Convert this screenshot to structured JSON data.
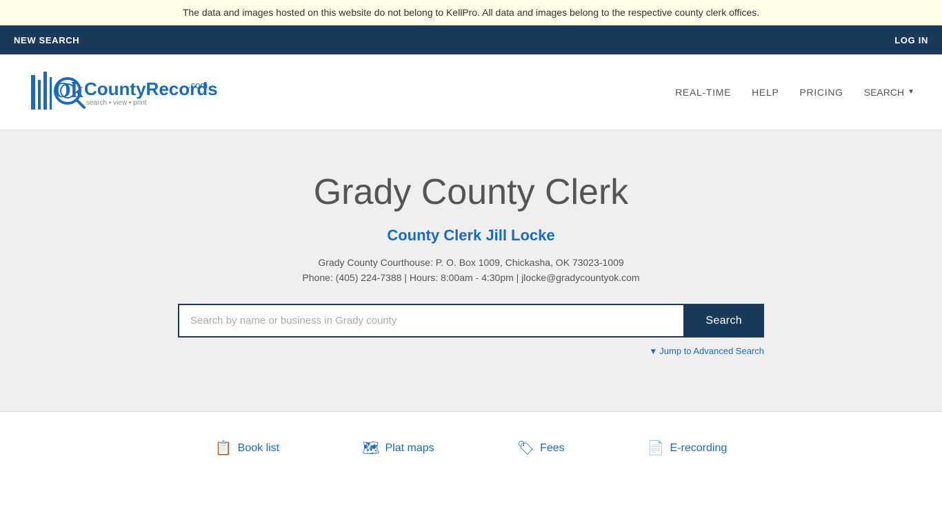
{
  "notice": {
    "text": "The data and images hosted on this website do not belong to KellPro. All data and images belong to the respective county clerk offices."
  },
  "topnav": {
    "new_search": "NEW SEARCH",
    "log_in": "LOG IN"
  },
  "header": {
    "logo_ok": "Ok",
    "logo_county": "County",
    "logo_records": "Records",
    "logo_com": ".com",
    "logo_tagline": "search • view • print",
    "nav_realtime": "REAL-TIME",
    "nav_help": "HELP",
    "nav_pricing": "PRICING",
    "nav_search": "SEARCH"
  },
  "hero": {
    "title": "Grady County Clerk",
    "clerk_name": "County Clerk Jill Locke",
    "address": "Grady County Courthouse: P. O. Box 1009, Chickasha, OK 73023-1009",
    "phone_hours": "Phone: (405) 224-7388 | Hours: 8:00am - 4:30pm | jlocke@gradycountyok.com",
    "search_placeholder": "Search by name or business in Grady county",
    "search_button": "Search",
    "advanced_link": "Jump to Advanced Search"
  },
  "footer": {
    "links": [
      {
        "icon": "📋",
        "label": "Book list"
      },
      {
        "icon": "🗺",
        "label": "Plat maps"
      },
      {
        "icon": "🏷",
        "label": "Fees"
      },
      {
        "icon": "📄",
        "label": "E-recording"
      }
    ]
  }
}
